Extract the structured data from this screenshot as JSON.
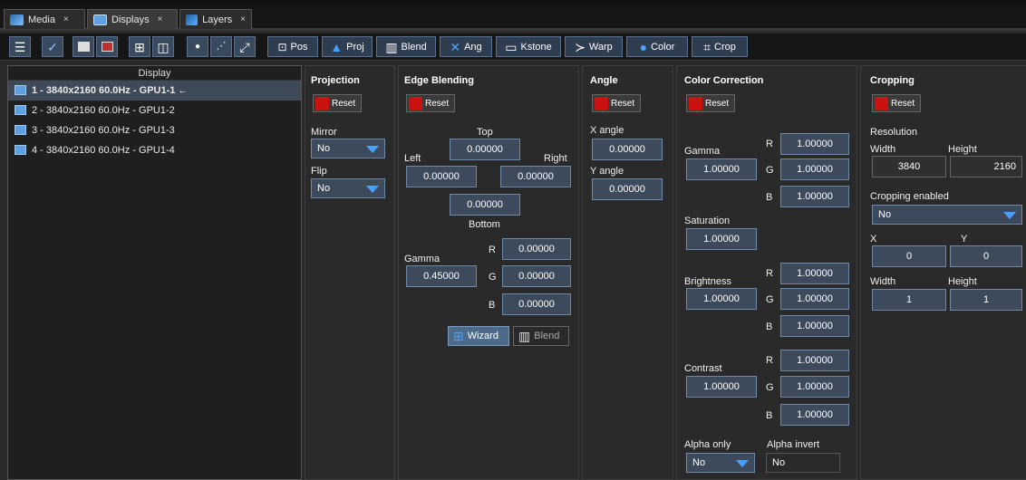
{
  "tabs": [
    {
      "label": "Media",
      "close": "×"
    },
    {
      "label": "Displays",
      "close": "×"
    },
    {
      "label": "Layers",
      "close": "×"
    }
  ],
  "toolbar": {
    "pos": "Pos",
    "proj": "Proj",
    "blend": "Blend",
    "ang": "Ang",
    "kstone": "Kstone",
    "warp": "Warp",
    "color": "Color",
    "crop": "Crop"
  },
  "display_list": {
    "header": "Display",
    "items": [
      {
        "label": "1 - 3840x2160 60.0Hz - GPU1-1 ←"
      },
      {
        "label": "2 - 3840x2160 60.0Hz - GPU1-2"
      },
      {
        "label": "3 - 3840x2160 60.0Hz - GPU1-3"
      },
      {
        "label": "4 - 3840x2160 60.0Hz - GPU1-4"
      }
    ]
  },
  "reset_label": "Reset",
  "projection": {
    "title": "Projection",
    "mirror_label": "Mirror",
    "mirror_value": "No",
    "flip_label": "Flip",
    "flip_value": "No"
  },
  "edge_blending": {
    "title": "Edge Blending",
    "top_label": "Top",
    "top": "0.00000",
    "left_label": "Left",
    "left": "0.00000",
    "right_label": "Right",
    "right": "0.00000",
    "bottom_label": "Bottom",
    "bottom": "0.00000",
    "gamma_label": "Gamma",
    "gamma": "0.45000",
    "r_label": "R",
    "r": "0.00000",
    "g_label": "G",
    "g": "0.00000",
    "b_label": "B",
    "b": "0.00000",
    "wizard": "Wizard",
    "blend": "Blend"
  },
  "angle": {
    "title": "Angle",
    "x_label": "X angle",
    "x": "0.00000",
    "y_label": "Y angle",
    "y": "0.00000"
  },
  "color_correction": {
    "title": "Color Correction",
    "gamma_label": "Gamma",
    "gamma": "1.00000",
    "gamma_r": "1.00000",
    "gamma_g": "1.00000",
    "gamma_b": "1.00000",
    "saturation_label": "Saturation",
    "saturation": "1.00000",
    "brightness_label": "Brightness",
    "brightness": "1.00000",
    "brightness_r": "1.00000",
    "brightness_g": "1.00000",
    "brightness_b": "1.00000",
    "contrast_label": "Contrast",
    "contrast": "1.00000",
    "contrast_r": "1.00000",
    "contrast_g": "1.00000",
    "contrast_b": "1.00000",
    "r": "R",
    "g": "G",
    "b": "B",
    "alpha_only_label": "Alpha only",
    "alpha_only": "No",
    "alpha_invert_label": "Alpha invert",
    "alpha_invert": "No"
  },
  "cropping": {
    "title": "Cropping",
    "resolution_label": "Resolution",
    "width_label": "Width",
    "height_label": "Height",
    "res_width": "3840",
    "res_height": "2160",
    "enabled_label": "Cropping enabled",
    "enabled": "No",
    "x_label": "X",
    "y_label": "Y",
    "x": "0",
    "y": "0",
    "crop_width_label": "Width",
    "crop_height_label": "Height",
    "crop_width": "1",
    "crop_height": "1"
  },
  "colors": {
    "accent": "#4aa0ff",
    "field": "#3c4a5c",
    "reset": "#cc1111"
  }
}
